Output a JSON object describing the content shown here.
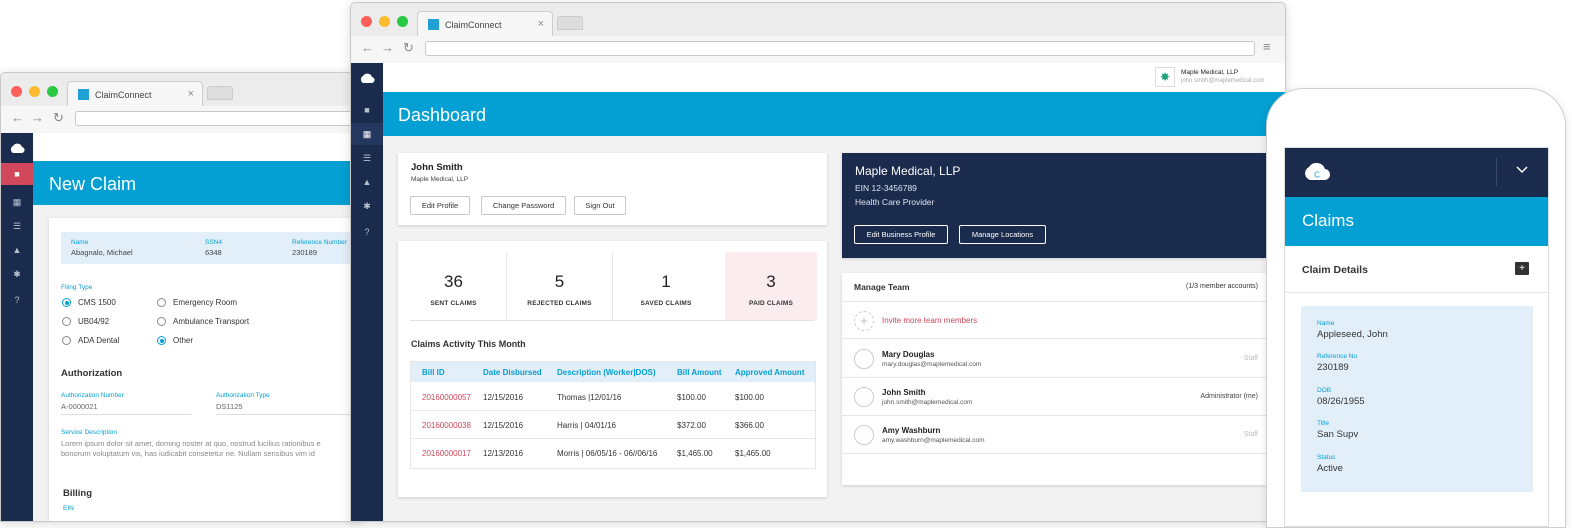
{
  "left_window": {
    "tab_title": "ClaimConnect",
    "page_title": "New Claim",
    "patient": {
      "name_label": "Name",
      "name": "Abagnalo, Michael",
      "ssn_label": "SSN4",
      "ssn": "6348",
      "ref_label": "Reference Number",
      "ref": "230189"
    },
    "filing_type_label": "Filing Type",
    "filing_options": [
      "CMS 1500",
      "UB04/92",
      "ADA Dental",
      "Emergency Room",
      "Ambulance Transport",
      "Other"
    ],
    "authorization_heading": "Authorization",
    "auth_number_label": "Authorization Number",
    "auth_number": "A-0000021",
    "auth_type_label": "Authorization Type",
    "auth_type": "DS1125",
    "service_desc_label": "Service Description",
    "service_desc_line1": "Lorem ipsum dolor sit amet, doming noster at quo, nostrud lucilius rationibus e",
    "service_desc_line2": "bonorum voluptatum vis, has iudicabit consetetur ne. Nullam sensibus vim id",
    "billing_heading": "Billing",
    "ein_label": "EIN"
  },
  "main_window": {
    "tab_title": "ClaimConnect",
    "org_name": "Maple Medical, LLP",
    "org_email": "john.smith@maplemedical.com",
    "page_title": "Dashboard",
    "profile": {
      "name": "John Smith",
      "org": "Maple Medical, LLP",
      "edit_profile": "Edit Profile",
      "change_password": "Change Password",
      "sign_out": "Sign Out"
    },
    "stats": [
      {
        "value": "36",
        "label": "SENT CLAIMS"
      },
      {
        "value": "5",
        "label": "REJECTED CLAIMS"
      },
      {
        "value": "1",
        "label": "SAVED CLAIMS"
      },
      {
        "value": "3",
        "label": "PAID CLAIMS"
      }
    ],
    "activity_title": "Claims Activity This Month",
    "table_headers": [
      "Bill ID",
      "Date Disbursed",
      "Description (Worker|DOS)",
      "Bill Amount",
      "Approved Amount"
    ],
    "table_rows": [
      [
        "20160000057",
        "12/15/2016",
        "Thomas |12/01/16",
        "$100.00",
        "$100.00"
      ],
      [
        "20160000038",
        "12/15/2016",
        "Harris | 04/01/16",
        "$372.00",
        "$366.00"
      ],
      [
        "20160000017",
        "12/13/2016",
        "Morris | 06/05/16 - 06//06/16",
        "$1,465.00",
        "$1,465.00"
      ]
    ],
    "business": {
      "name": "Maple Medical, LLP",
      "ein": "EIN 12-3456789",
      "type": "Health Care Provider",
      "edit_btn": "Edit Business Profile",
      "locations_btn": "Manage Locations"
    },
    "team": {
      "title": "Manage Team",
      "count": "(1/3 member accounts)",
      "invite": "Invite more team members",
      "members": [
        {
          "name": "Mary Douglas",
          "email": "mary.douglas@maplemedical.com",
          "role": "Staff"
        },
        {
          "name": "John Smith",
          "email": "john.smith@maplemedical.com",
          "role": "Administrator (me)"
        },
        {
          "name": "Amy Washburn",
          "email": "amy.washburn@maplemedical.com",
          "role": "Staff"
        }
      ]
    }
  },
  "mobile": {
    "page_title": "Claims",
    "section_title": "Claim Details",
    "fields": [
      {
        "label": "Name",
        "value": "Appleseed, John"
      },
      {
        "label": "Reference No",
        "value": "230189"
      },
      {
        "label": "DOB",
        "value": "08/26/1955"
      },
      {
        "label": "Title",
        "value": "San Supv"
      },
      {
        "label": "Status",
        "value": "Active"
      }
    ]
  },
  "colors": {
    "accent": "#049fd3",
    "sidebar": "#1b2b4d",
    "bill_link": "#d1475b",
    "paid_bg": "#fbecee"
  }
}
